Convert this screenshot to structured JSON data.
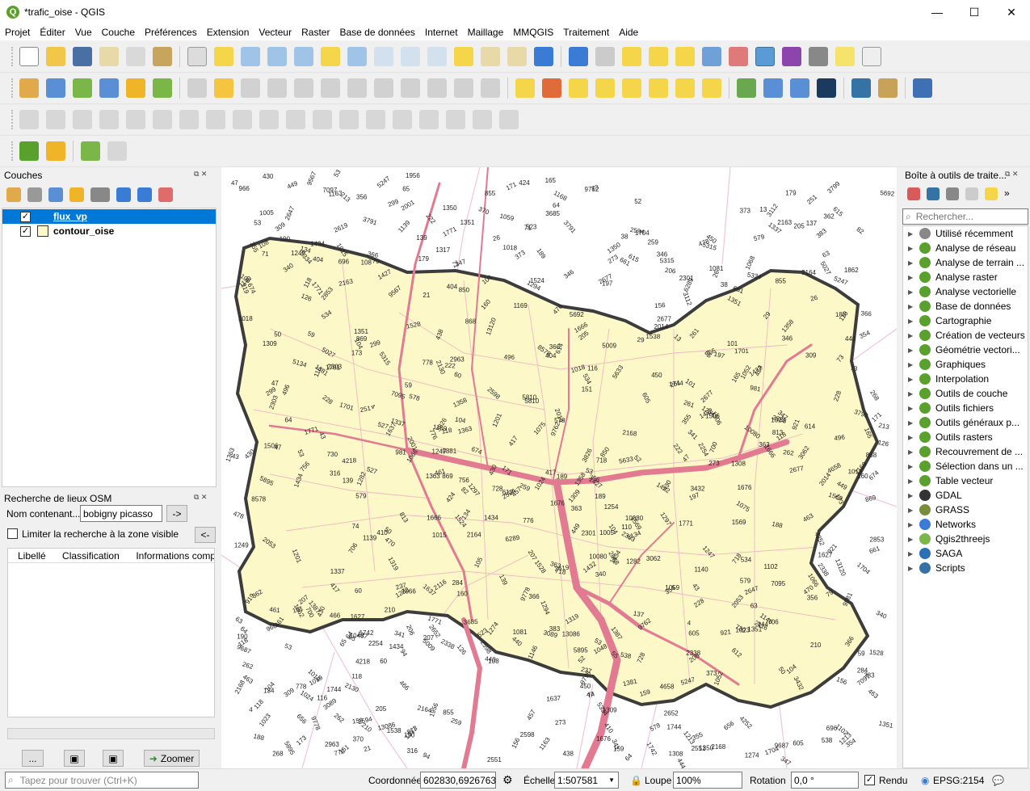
{
  "window": {
    "title": "*trafic_oise - QGIS",
    "minimize": "—",
    "maximize": "☐",
    "close": "✕"
  },
  "menu": [
    "Projet",
    "Éditer",
    "Vue",
    "Couche",
    "Préférences",
    "Extension",
    "Vecteur",
    "Raster",
    "Base de données",
    "Internet",
    "Maillage",
    "MMQGIS",
    "Traitement",
    "Aide"
  ],
  "layers_panel": {
    "title": "Couches",
    "layers": [
      {
        "name": "flux_vp",
        "checked": true,
        "selected": true
      },
      {
        "name": "contour_oise",
        "checked": true,
        "selected": false
      }
    ]
  },
  "osm_panel": {
    "title": "Recherche de lieux OSM",
    "field_label": "Nom contenant...",
    "field_value": "bobigny picasso",
    "go_button": "->",
    "limit_label": "Limiter la recherche à la zone visible",
    "back_button": "<-",
    "columns": [
      "Libellé",
      "Classification",
      "Informations comp"
    ],
    "more_button": "...",
    "zoom_button": "Zoomer"
  },
  "toolbox": {
    "title": "Boîte à outils de traite...",
    "search_placeholder": "Rechercher...",
    "items": [
      {
        "label": "Utilisé récemment",
        "icon": "clock-icon",
        "color": "#888888"
      },
      {
        "label": "Analyse de réseau",
        "icon": "qgis-icon",
        "color": "#5aa02c"
      },
      {
        "label": "Analyse de terrain ...",
        "icon": "qgis-icon",
        "color": "#5aa02c"
      },
      {
        "label": "Analyse raster",
        "icon": "qgis-icon",
        "color": "#5aa02c"
      },
      {
        "label": "Analyse vectorielle",
        "icon": "qgis-icon",
        "color": "#5aa02c"
      },
      {
        "label": "Base de données",
        "icon": "qgis-icon",
        "color": "#5aa02c"
      },
      {
        "label": "Cartographie",
        "icon": "qgis-icon",
        "color": "#5aa02c"
      },
      {
        "label": "Création de vecteurs",
        "icon": "qgis-icon",
        "color": "#5aa02c"
      },
      {
        "label": "Géométrie vectori...",
        "icon": "qgis-icon",
        "color": "#5aa02c"
      },
      {
        "label": "Graphiques",
        "icon": "qgis-icon",
        "color": "#5aa02c"
      },
      {
        "label": "Interpolation",
        "icon": "qgis-icon",
        "color": "#5aa02c"
      },
      {
        "label": "Outils de couche",
        "icon": "qgis-icon",
        "color": "#5aa02c"
      },
      {
        "label": "Outils fichiers",
        "icon": "qgis-icon",
        "color": "#5aa02c"
      },
      {
        "label": "Outils généraux p...",
        "icon": "qgis-icon",
        "color": "#5aa02c"
      },
      {
        "label": "Outils rasters",
        "icon": "qgis-icon",
        "color": "#5aa02c"
      },
      {
        "label": "Recouvrement de ...",
        "icon": "qgis-icon",
        "color": "#5aa02c"
      },
      {
        "label": "Sélection dans un ...",
        "icon": "qgis-icon",
        "color": "#5aa02c"
      },
      {
        "label": "Table vecteur",
        "icon": "qgis-icon",
        "color": "#5aa02c"
      },
      {
        "label": "GDAL",
        "icon": "gdal-icon",
        "color": "#333333"
      },
      {
        "label": "GRASS",
        "icon": "grass-icon",
        "color": "#7a8c3a"
      },
      {
        "label": "Networks",
        "icon": "networks-icon",
        "color": "#3a7bd5"
      },
      {
        "label": "Qgis2threejs",
        "icon": "threejs-icon",
        "color": "#7ab648"
      },
      {
        "label": "SAGA",
        "icon": "saga-icon",
        "color": "#2c6fb7"
      },
      {
        "label": "Scripts",
        "icon": "python-icon",
        "color": "#3572a5"
      }
    ]
  },
  "map": {
    "fill": "#fdf8c8",
    "border": "#3c3c3c",
    "flow": "#e27a92",
    "labels": [
      "1676",
      "1637",
      "463",
      "534",
      "470",
      "718",
      "1023",
      "2598",
      "2594",
      "151",
      "116",
      "165",
      "188",
      "50",
      "346",
      "71",
      "139",
      "118",
      "118",
      "210",
      "206",
      "156",
      "73",
      "4",
      "190",
      "134",
      "126",
      "189",
      "65",
      "43",
      "60",
      "53",
      "52",
      "64",
      "47",
      "207",
      "53",
      "26",
      "63",
      "259",
      "59",
      "137",
      "173",
      "2168",
      "2014",
      "2338",
      "222",
      "171",
      "1569",
      "813",
      "869",
      "921",
      "356",
      "674",
      "1337",
      "1282",
      "160",
      "104",
      "197",
      "108",
      "104",
      "340",
      "430",
      "461",
      "383",
      "855",
      "373",
      "205",
      "273",
      "159",
      "366",
      "366",
      "354",
      "262",
      "261",
      "355",
      "424",
      "440",
      "449",
      "228",
      "496",
      "309",
      "299",
      "1528",
      "1506",
      "404",
      "363",
      "1434",
      "1363",
      "1704",
      "776",
      "2164",
      "347",
      "1309",
      "1015",
      "605",
      "661",
      "1018",
      "1350",
      "1358",
      "1351",
      "1701",
      "1771",
      "1666",
      "1744",
      "341",
      "417",
      "578",
      "579",
      "450",
      "2303",
      "9778",
      "9762",
      "10080",
      "5895",
      "5315",
      "5247",
      "5334",
      "5633",
      "5810",
      "5692",
      "2853",
      "1538",
      "1247",
      "1249",
      "1052",
      "919",
      "966",
      "1005",
      "981",
      "1168",
      "1213",
      "1059",
      "1381",
      "1387",
      "1427",
      "1422",
      "1956",
      "2130",
      "1351",
      "1048",
      "1146",
      "1771",
      "1274",
      "1075",
      "868",
      "696",
      "1068",
      "2301",
      "2619",
      "3791",
      "3799",
      "3089",
      "3685",
      "3062",
      "2647",
      "1297",
      "1254",
      "2551",
      "1201",
      "2001",
      "2652",
      "2254",
      "1019",
      "1024",
      "1081",
      "1102",
      "1139",
      "1169",
      "1319",
      "1434",
      "13120",
      "13086",
      "4658",
      "2963",
      "3112",
      "2888",
      "2163",
      "2116",
      "1862",
      "1742",
      "1627",
      "1524",
      "5009",
      "5027",
      "2053",
      "2677",
      "2677",
      "3432",
      "4252",
      "6289",
      "4218",
      "9881",
      "9687",
      "9567",
      "8578",
      "5134",
      "3826",
      "1308",
      "1432",
      "7095",
      "7097",
      "1317",
      "1294",
      "1163",
      "1140",
      "1066",
      "756",
      "778",
      "850",
      "538",
      "612",
      "730",
      "706",
      "728",
      "615",
      "700",
      "614",
      "656",
      "523",
      "527",
      "430",
      "466",
      "410",
      "444",
      "438",
      "457",
      "478",
      "370",
      "362",
      "316",
      "284",
      "251",
      "268",
      "237",
      "213",
      "179",
      "110",
      "105",
      "101",
      "94",
      "82",
      "79",
      "74",
      "64",
      "55",
      "47",
      "38",
      "29",
      "21",
      "13"
    ]
  },
  "status": {
    "search_placeholder": "Tapez pour trouver (Ctrl+K)",
    "coord_label": "Coordonnée",
    "coord_value": "602830,6926763",
    "scale_label": "Échelle",
    "scale_value": "1:507581",
    "zoom_label": "Loupe",
    "zoom_value": "100%",
    "rotation_label": "Rotation",
    "rotation_value": "0,0 °",
    "render_label": "Rendu",
    "crs_label": "EPSG:2154"
  }
}
